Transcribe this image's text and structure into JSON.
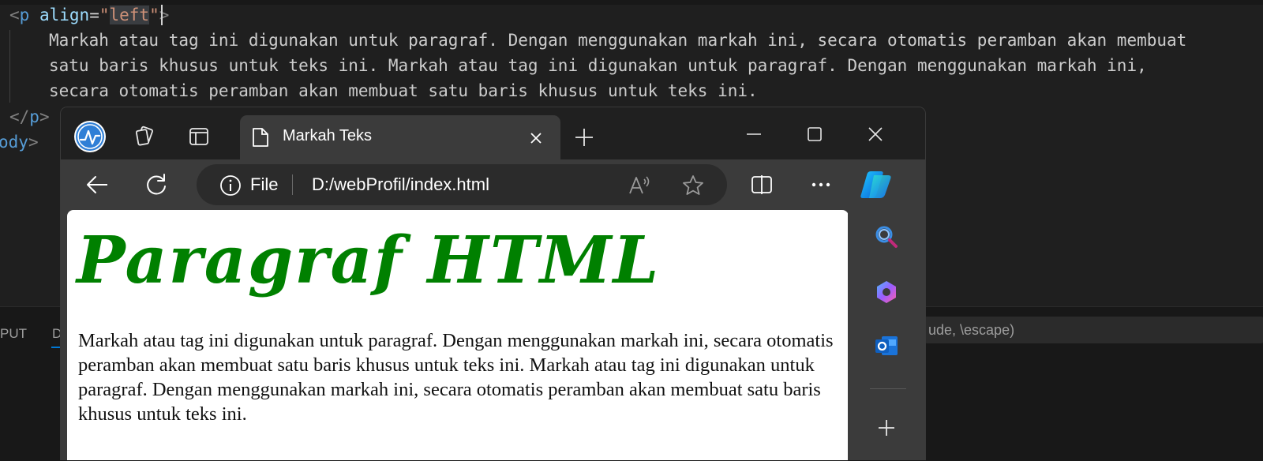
{
  "editor": {
    "lines": [
      {
        "open": "<",
        "tag": "p",
        "attr": "align",
        "eq": "=",
        "quote": "\"",
        "value": "left",
        "quote_end": "\"",
        "close": ">"
      },
      {
        "text": "Markah atau tag ini digunakan untuk paragraf. Dengan menggunakan markah ini, secara otomatis peramban akan membuat"
      },
      {
        "text": "satu baris khusus untuk teks ini. Markah atau tag ini digunakan untuk paragraf. Dengan menggunakan markah ini,"
      },
      {
        "text": "secara otomatis peramban akan membuat satu baris khusus untuk teks ini."
      },
      {
        "open": "</",
        "tag": "p",
        "close": ">"
      },
      {
        "tag": "ody",
        "close": ">"
      }
    ]
  },
  "panel": {
    "tab_output": "PUT",
    "tab_debug": "D",
    "filter_placeholder": "ude, \\escape)"
  },
  "browser": {
    "tab_title": "Markah Teks",
    "address_scheme": "File",
    "address_url": "D:/webProfil/index.html",
    "page": {
      "heading": "Paragraf HTML",
      "paragraph": "Markah atau tag ini digunakan untuk paragraf. Dengan menggunakan markah ini, secara otomatis peramban akan membuat satu baris khusus untuk teks ini. Markah atau tag ini digunakan untuk paragraf. Dengan menggunakan markah ini, secara otomatis peramban akan membuat satu baris khusus untuk teks ini."
    },
    "toolbar_icons": [
      "back-arrow-icon",
      "refresh-icon",
      "info-icon",
      "read-aloud-icon",
      "favorite-star-icon",
      "split-screen-icon",
      "more-dots-icon",
      "copilot-icon"
    ],
    "sidebar_icons": [
      "search-icon",
      "copilot-sidebar-icon",
      "outlook-icon",
      "plus-icon"
    ]
  },
  "colors": {
    "heading_green": "#008000",
    "editor_bg": "#1f1f1f",
    "browser_frame": "#3b3b3b",
    "accent_blue": "#0078d4"
  }
}
